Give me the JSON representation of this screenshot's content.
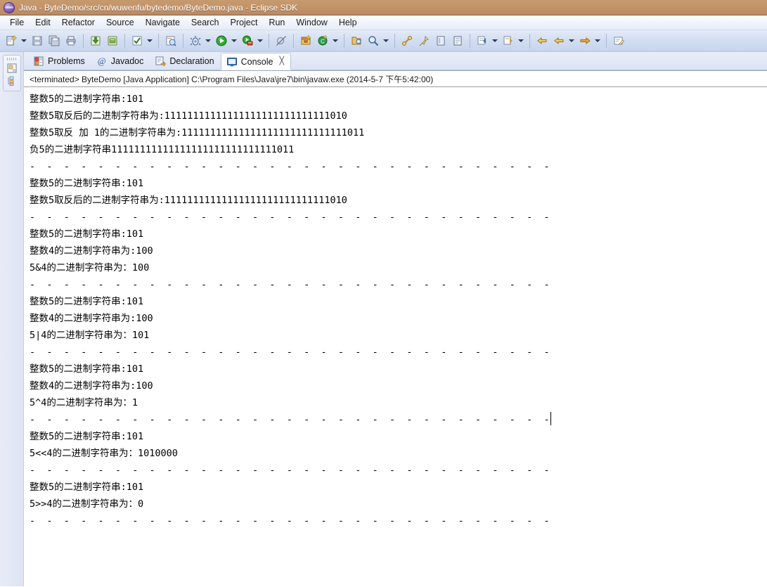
{
  "window": {
    "title": "Java - ByteDemo/src/cn/wuwenfu/bytedemo/ByteDemo.java - Eclipse SDK",
    "icon": "java-perspective-icon"
  },
  "menubar": {
    "items": [
      {
        "label": "File"
      },
      {
        "label": "Edit"
      },
      {
        "label": "Refactor"
      },
      {
        "label": "Source"
      },
      {
        "label": "Navigate"
      },
      {
        "label": "Search"
      },
      {
        "label": "Project"
      },
      {
        "label": "Run"
      },
      {
        "label": "Window"
      },
      {
        "label": "Help"
      }
    ]
  },
  "toolbar": {
    "groups": [
      {
        "buttons": [
          {
            "name": "new-wizard-icon",
            "has_arrow": true
          },
          {
            "name": "save-icon",
            "has_arrow": false
          },
          {
            "name": "save-all-icon",
            "has_arrow": false
          },
          {
            "name": "print-icon",
            "has_arrow": false
          }
        ]
      },
      {
        "buttons": [
          {
            "name": "import-icon",
            "has_arrow": false
          },
          {
            "name": "export-icon",
            "has_arrow": false
          }
        ]
      },
      {
        "buttons": [
          {
            "name": "build-all-icon",
            "has_arrow": true
          }
        ]
      },
      {
        "buttons": [
          {
            "name": "open-type-icon",
            "has_arrow": false
          }
        ]
      },
      {
        "buttons": [
          {
            "name": "debug-icon",
            "has_arrow": true
          },
          {
            "name": "run-icon",
            "has_arrow": true
          },
          {
            "name": "run-external-tools-icon",
            "has_arrow": true
          }
        ]
      },
      {
        "buttons": [
          {
            "name": "skip-breakpoints-icon",
            "has_arrow": false
          }
        ]
      },
      {
        "buttons": [
          {
            "name": "new-java-package-icon",
            "has_arrow": false
          },
          {
            "name": "new-java-class-icon",
            "has_arrow": true
          }
        ]
      },
      {
        "buttons": [
          {
            "name": "open-task-icon",
            "has_arrow": false
          },
          {
            "name": "search-icon",
            "has_arrow": true
          }
        ]
      },
      {
        "buttons": [
          {
            "name": "link-editor-icon",
            "has_arrow": false
          },
          {
            "name": "pin-editor-icon",
            "has_arrow": false
          },
          {
            "name": "toggle-block-selection-icon",
            "has_arrow": false
          },
          {
            "name": "show-whitespace-icon",
            "has_arrow": false
          }
        ]
      },
      {
        "buttons": [
          {
            "name": "previous-annotation-icon",
            "has_arrow": true
          },
          {
            "name": "next-annotation-icon",
            "has_arrow": true
          }
        ]
      },
      {
        "buttons": [
          {
            "name": "back-icon",
            "has_arrow": false
          },
          {
            "name": "forward-icon",
            "has_arrow": true
          },
          {
            "name": "forward-history-icon",
            "has_arrow": true
          }
        ]
      },
      {
        "buttons": [
          {
            "name": "last-edit-location-icon",
            "has_arrow": false
          }
        ]
      }
    ]
  },
  "fastview": {
    "icons": [
      {
        "name": "package-explorer-icon"
      },
      {
        "name": "outline-view-icon"
      }
    ]
  },
  "tabs": [
    {
      "label": "Problems",
      "icon": "problems-icon",
      "active": false,
      "closable": false
    },
    {
      "label": "Javadoc",
      "icon": "javadoc-icon",
      "active": false,
      "closable": false
    },
    {
      "label": "Declaration",
      "icon": "declaration-icon",
      "active": false,
      "closable": false
    },
    {
      "label": "Console",
      "icon": "console-icon",
      "active": true,
      "closable": true,
      "close_glyph": "╳"
    }
  ],
  "console": {
    "stack_line": "<terminated> ByteDemo [Java Application] C:\\Program Files\\Java\\jre7\\bin\\javaw.exe (2014-5-7 下午5:42:00)",
    "separator": "-  -  -  -  -  -  -  -  -  -  -  -  -  -  -  -  -  -  -  -  -  -  -  -  -  -  -  -  -  -  -",
    "lines": [
      {
        "text": "整数5的二进制字符串:101"
      },
      {
        "text": "整数5取反后的二进制字符串为:11111111111111111111111111111010"
      },
      {
        "text": "整数5取反 加 1的二进制字符串为:11111111111111111111111111111011"
      },
      {
        "text": "负5的二进制字符串11111111111111111111111111111011"
      },
      {
        "text": "-  -  -  -  -  -  -  -  -  -  -  -  -  -  -  -  -  -  -  -  -  -  -  -  -  -  -  -  -  -  -"
      },
      {
        "text": "整数5的二进制字符串:101"
      },
      {
        "text": "整数5取反后的二进制字符串为:11111111111111111111111111111010"
      },
      {
        "text": "-  -  -  -  -  -  -  -  -  -  -  -  -  -  -  -  -  -  -  -  -  -  -  -  -  -  -  -  -  -  -"
      },
      {
        "text": "整数5的二进制字符串:101"
      },
      {
        "text": "整数4的二进制字符串为:100"
      },
      {
        "text": "5&4的二进制字符串为：100"
      },
      {
        "text": "-  -  -  -  -  -  -  -  -  -  -  -  -  -  -  -  -  -  -  -  -  -  -  -  -  -  -  -  -  -  -"
      },
      {
        "text": "整数5的二进制字符串:101"
      },
      {
        "text": "整数4的二进制字符串为:100"
      },
      {
        "text": "5|4的二进制字符串为：101"
      },
      {
        "text": "-  -  -  -  -  -  -  -  -  -  -  -  -  -  -  -  -  -  -  -  -  -  -  -  -  -  -  -  -  -  -"
      },
      {
        "text": "整数5的二进制字符串:101"
      },
      {
        "text": "整数4的二进制字符串为:100"
      },
      {
        "text": "5^4的二进制字符串为：1"
      },
      {
        "text": "-  -  -  -  -  -  -  -  -  -  -  -  -  -  -  -  -  -  -  -  -  -  -  -  -  -  -  -  -  -  -",
        "caret": true
      },
      {
        "text": "整数5的二进制字符串:101"
      },
      {
        "text": "5<<4的二进制字符串为：1010000"
      },
      {
        "text": "-  -  -  -  -  -  -  -  -  -  -  -  -  -  -  -  -  -  -  -  -  -  -  -  -  -  -  -  -  -  -"
      },
      {
        "text": "整数5的二进制字符串:101"
      },
      {
        "text": "5>>4的二进制字符串为：0"
      },
      {
        "text": "-  -  -  -  -  -  -  -  -  -  -  -  -  -  -  -  -  -  -  -  -  -  -  -  -  -  -  -  -  -  -"
      }
    ]
  },
  "colors": {
    "titlebar": "#c2926a",
    "toolbar": "#d4def2",
    "console_bg": "#ffffff",
    "text": "#000000",
    "tab_active_bg": "#ffffff"
  }
}
